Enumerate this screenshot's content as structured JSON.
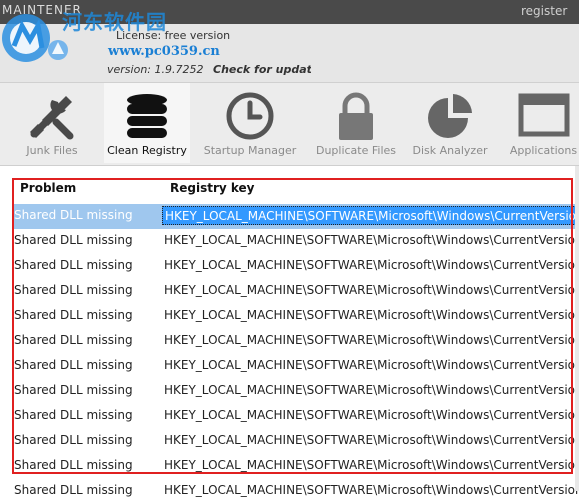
{
  "app": {
    "title": "MAINTENER",
    "register_label": "register",
    "watermark_text": "河东软件园",
    "watermark_url": "www.pc0359.cn",
    "license_text": "License: free version",
    "version_text": "version: 1.9.7252",
    "check_updates_label": "Check for updates"
  },
  "toolbar": {
    "tools": [
      {
        "label": "Junk Files",
        "icon": "tools-icon",
        "active": false
      },
      {
        "label": "Clean Registry",
        "icon": "database-icon",
        "active": true
      },
      {
        "label": "Startup Manager",
        "icon": "clock-icon",
        "active": false
      },
      {
        "label": "Duplicate Files",
        "icon": "lock-icon",
        "active": false
      },
      {
        "label": "Disk Analyzer",
        "icon": "pie-chart-icon",
        "active": false
      },
      {
        "label": "Applications",
        "icon": "window-icon",
        "active": false
      }
    ]
  },
  "table": {
    "columns": [
      "Problem",
      "Registry key"
    ],
    "rows": [
      {
        "problem": "Shared DLL missing",
        "key": "HKEY_LOCAL_MACHINE\\SOFTWARE\\Microsoft\\Windows\\CurrentVersion\\SharedDLLs",
        "selected": true
      },
      {
        "problem": "Shared DLL missing",
        "key": "HKEY_LOCAL_MACHINE\\SOFTWARE\\Microsoft\\Windows\\CurrentVersion\\SharedDLLs"
      },
      {
        "problem": "Shared DLL missing",
        "key": "HKEY_LOCAL_MACHINE\\SOFTWARE\\Microsoft\\Windows\\CurrentVersion\\SharedDLLs"
      },
      {
        "problem": "Shared DLL missing",
        "key": "HKEY_LOCAL_MACHINE\\SOFTWARE\\Microsoft\\Windows\\CurrentVersion\\SharedDLLs"
      },
      {
        "problem": "Shared DLL missing",
        "key": "HKEY_LOCAL_MACHINE\\SOFTWARE\\Microsoft\\Windows\\CurrentVersion\\SharedDLLs"
      },
      {
        "problem": "Shared DLL missing",
        "key": "HKEY_LOCAL_MACHINE\\SOFTWARE\\Microsoft\\Windows\\CurrentVersion\\SharedDLLs"
      },
      {
        "problem": "Shared DLL missing",
        "key": "HKEY_LOCAL_MACHINE\\SOFTWARE\\Microsoft\\Windows\\CurrentVersion\\SharedDLLs"
      },
      {
        "problem": "Shared DLL missing",
        "key": "HKEY_LOCAL_MACHINE\\SOFTWARE\\Microsoft\\Windows\\CurrentVersion\\SharedDLLs"
      },
      {
        "problem": "Shared DLL missing",
        "key": "HKEY_LOCAL_MACHINE\\SOFTWARE\\Microsoft\\Windows\\CurrentVersion\\SharedDLLs"
      },
      {
        "problem": "Shared DLL missing",
        "key": "HKEY_LOCAL_MACHINE\\SOFTWARE\\Microsoft\\Windows\\CurrentVersion\\SharedDLLs"
      },
      {
        "problem": "Shared DLL missing",
        "key": "HKEY_LOCAL_MACHINE\\SOFTWARE\\Microsoft\\Windows\\CurrentVersion\\SharedDLLs"
      },
      {
        "problem": "Shared DLL missing",
        "key": "HKEY_LOCAL_MACHINE\\SOFTWARE\\Microsoft\\Windows\\CurrentVersion\\SharedDLLs"
      }
    ]
  },
  "colors": {
    "highlight_frame": "#e02020",
    "selection": "#3399ff",
    "header_dark": "#4a4a4a"
  }
}
